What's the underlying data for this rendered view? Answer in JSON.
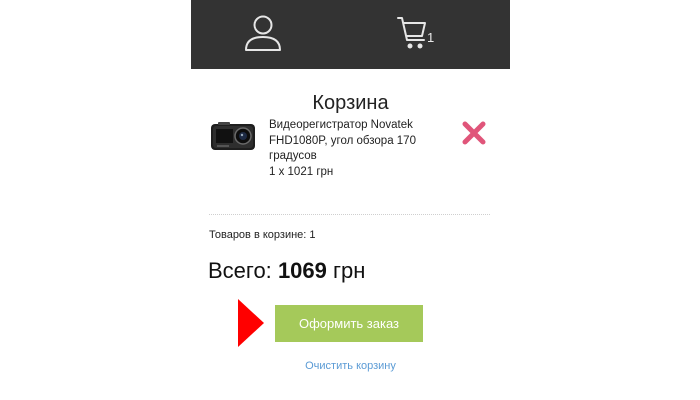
{
  "header": {
    "user_icon": "user-icon",
    "cart_icon": "cart-icon",
    "cart_count": "1"
  },
  "cart": {
    "title": "Корзина",
    "item": {
      "name": "Видеорегистратор Novatek FHD1080P, угол обзора 170 градусов",
      "quantity_price": "1 x 1021 грн",
      "image_icon": "dashcam-image",
      "remove_icon": "close-icon"
    },
    "items_count_text": "Товаров в корзине: 1",
    "total_label": "Всего:",
    "total_value": "1069",
    "total_currency": "грн",
    "checkout_label": "Оформить заказ",
    "clear_label": "Очистить корзину"
  },
  "colors": {
    "header_bg": "#333333",
    "checkout_bg": "#a5c95a",
    "remove_icon": "#e0557a",
    "pointer_arrow": "#ff0000",
    "link": "#5b9bd5"
  }
}
